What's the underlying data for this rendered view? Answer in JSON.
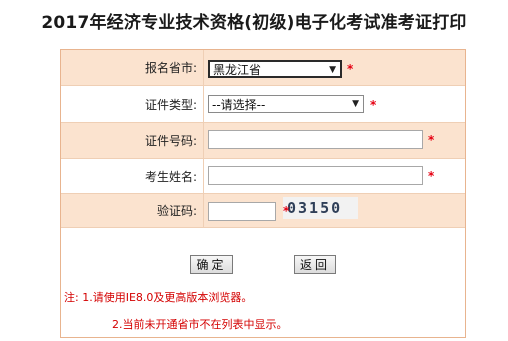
{
  "page": {
    "title": "2017年经济专业技术资格(初级)电子化考试准考证打印"
  },
  "form": {
    "province": {
      "label": "报名省市:",
      "value": "黑龙江省"
    },
    "cert_type": {
      "label": "证件类型:",
      "value": "--请选择--"
    },
    "cert_number": {
      "label": "证件号码:",
      "value": ""
    },
    "name": {
      "label": "考生姓名:",
      "value": ""
    },
    "captcha": {
      "label": "验证码:",
      "value": "",
      "image_text": "03150"
    },
    "required_mark": "*"
  },
  "buttons": {
    "confirm": "确定",
    "back": "返回"
  },
  "notes": {
    "line1": "注: 1.请使用IE8.0及更高版本浏览器。",
    "line2": "2.当前未开通省市不在列表中显示。"
  },
  "colors": {
    "row_highlight": "#fbe3cf",
    "border": "#e8b48f",
    "required": "#e60012",
    "note": "#d40000"
  }
}
